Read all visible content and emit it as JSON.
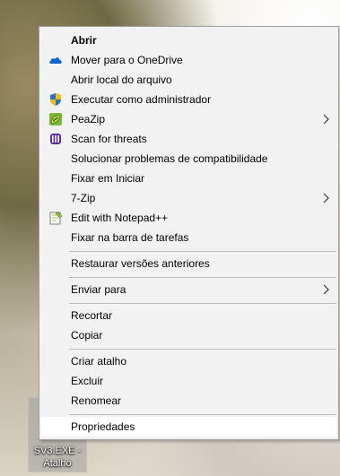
{
  "desktop": {
    "shortcut_label_line1": "SV3.EXE -",
    "shortcut_label_line2": "Atalho"
  },
  "menu": {
    "items": [
      {
        "label": "Abrir",
        "icon": "",
        "bold": true
      },
      {
        "label": "Mover para o OneDrive",
        "icon": "onedrive-icon"
      },
      {
        "label": "Abrir local do arquivo",
        "icon": ""
      },
      {
        "label": "Executar como administrador",
        "icon": "uac-shield-icon"
      },
      {
        "label": "PeaZip",
        "icon": "peazip-icon",
        "submenu": true
      },
      {
        "label": "Scan for threats",
        "icon": "antivirus-scan-icon"
      },
      {
        "label": "Solucionar problemas de compatibilidade",
        "icon": ""
      },
      {
        "label": "Fixar em Iniciar",
        "icon": ""
      },
      {
        "label": "7-Zip",
        "icon": "",
        "submenu": true
      },
      {
        "label": "Edit with Notepad++",
        "icon": "notepadpp-icon"
      },
      {
        "label": "Fixar na barra de tarefas",
        "icon": ""
      },
      {
        "label": "Restaurar versões anteriores",
        "icon": ""
      },
      {
        "label": "Enviar para",
        "icon": "",
        "submenu": true
      },
      {
        "label": "Recortar",
        "icon": ""
      },
      {
        "label": "Copiar",
        "icon": ""
      },
      {
        "label": "Criar atalho",
        "icon": ""
      },
      {
        "label": "Excluir",
        "icon": ""
      },
      {
        "label": "Renomear",
        "icon": ""
      },
      {
        "label": "Propriedades",
        "icon": "",
        "highlighted": true
      }
    ]
  },
  "colors": {
    "menu_bg": "#f2f2f2",
    "highlight_bg": "#ffffff",
    "separator": "#bcbcbc",
    "onedrive_blue": "#0a64d6",
    "shield_blue": "#2a72c8",
    "shield_yellow": "#f4c20d",
    "peazip_green": "#7ab83a",
    "scan_purple": "#5a2bb5"
  }
}
